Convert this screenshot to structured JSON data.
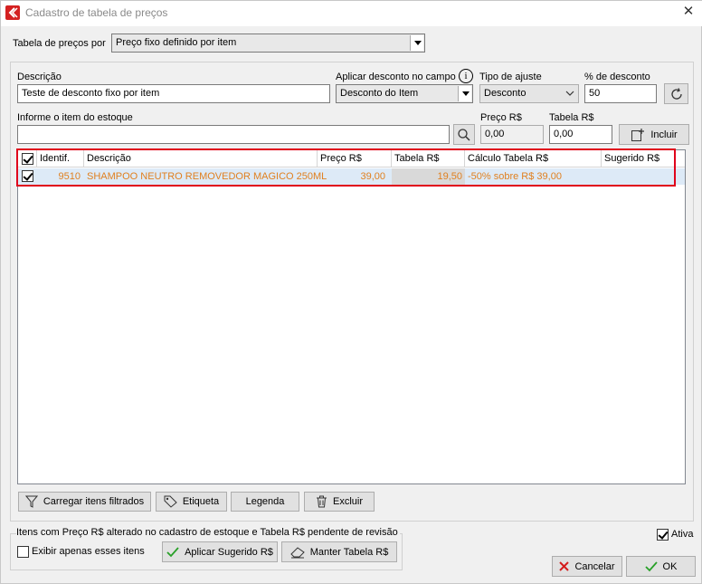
{
  "window": {
    "title": "Cadastro de tabela de preços",
    "close_icon": "close-icon"
  },
  "header": {
    "tabela_label": "Tabela de preços por",
    "tabela_value": "Preço fixo definido por item"
  },
  "form": {
    "descricao_label": "Descrição",
    "descricao_value": "Teste de desconto fixo por item",
    "aplicar_label": "Aplicar desconto no campo",
    "aplicar_value": "Desconto do Item",
    "tipo_label": "Tipo de ajuste",
    "tipo_value": "Desconto",
    "percent_label": "% de desconto",
    "percent_value": "50",
    "item_label": "Informe o item do estoque",
    "item_value": "",
    "preco_label": "Preço R$",
    "preco_value": "0,00",
    "tabela_label": "Tabela R$",
    "tabela_value": "0,00",
    "incluir_label": "Incluir"
  },
  "grid": {
    "columns": [
      "Identif.",
      "Descrição",
      "Preço R$",
      "Tabela R$",
      "Cálculo Tabela R$",
      "Sugerido R$"
    ],
    "rows": [
      {
        "checked": true,
        "id": "9510",
        "descricao": "SHAMPOO NEUTRO REMOVEDOR MAGICO 250ML",
        "preco": "39,00",
        "tabela": "19,50",
        "calculo": "-50% sobre R$ 39,00",
        "sugerido": ""
      }
    ]
  },
  "toolbar": {
    "carregar": "Carregar itens filtrados",
    "etiqueta": "Etiqueta",
    "legenda": "Legenda",
    "excluir": "Excluir"
  },
  "footer": {
    "pending_text": "Itens com Preço R$ alterado no cadastro de estoque e Tabela R$ pendente de revisão",
    "exibir_label": "Exibir apenas esses itens",
    "aplicar_sugerido": "Aplicar Sugerido R$",
    "manter_tabela": "Manter Tabela R$",
    "ativa_label": "Ativa",
    "cancelar": "Cancelar",
    "ok": "OK"
  },
  "colors": {
    "accent_red": "#e0001b",
    "row_text": "#e08020",
    "row_bg": "#ddeaf7"
  }
}
